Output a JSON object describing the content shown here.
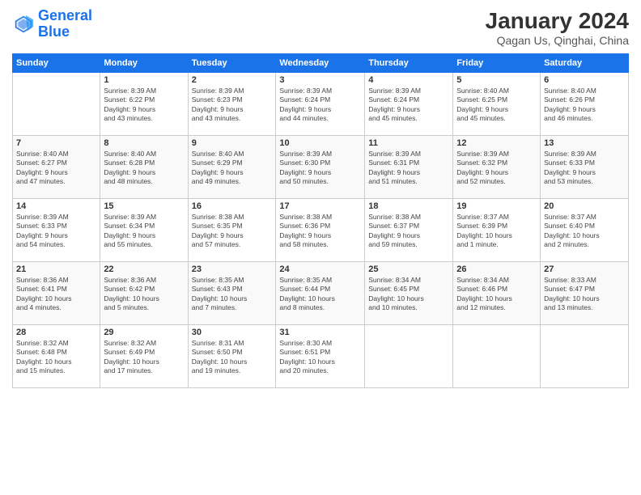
{
  "logo": {
    "line1": "General",
    "line2": "Blue"
  },
  "header": {
    "title": "January 2024",
    "subtitle": "Qagan Us, Qinghai, China"
  },
  "columns": [
    "Sunday",
    "Monday",
    "Tuesday",
    "Wednesday",
    "Thursday",
    "Friday",
    "Saturday"
  ],
  "weeks": [
    [
      {
        "day": "",
        "info": ""
      },
      {
        "day": "1",
        "info": "Sunrise: 8:39 AM\nSunset: 6:22 PM\nDaylight: 9 hours\nand 43 minutes."
      },
      {
        "day": "2",
        "info": "Sunrise: 8:39 AM\nSunset: 6:23 PM\nDaylight: 9 hours\nand 43 minutes."
      },
      {
        "day": "3",
        "info": "Sunrise: 8:39 AM\nSunset: 6:24 PM\nDaylight: 9 hours\nand 44 minutes."
      },
      {
        "day": "4",
        "info": "Sunrise: 8:39 AM\nSunset: 6:24 PM\nDaylight: 9 hours\nand 45 minutes."
      },
      {
        "day": "5",
        "info": "Sunrise: 8:40 AM\nSunset: 6:25 PM\nDaylight: 9 hours\nand 45 minutes."
      },
      {
        "day": "6",
        "info": "Sunrise: 8:40 AM\nSunset: 6:26 PM\nDaylight: 9 hours\nand 46 minutes."
      }
    ],
    [
      {
        "day": "7",
        "info": "Sunrise: 8:40 AM\nSunset: 6:27 PM\nDaylight: 9 hours\nand 47 minutes."
      },
      {
        "day": "8",
        "info": "Sunrise: 8:40 AM\nSunset: 6:28 PM\nDaylight: 9 hours\nand 48 minutes."
      },
      {
        "day": "9",
        "info": "Sunrise: 8:40 AM\nSunset: 6:29 PM\nDaylight: 9 hours\nand 49 minutes."
      },
      {
        "day": "10",
        "info": "Sunrise: 8:39 AM\nSunset: 6:30 PM\nDaylight: 9 hours\nand 50 minutes."
      },
      {
        "day": "11",
        "info": "Sunrise: 8:39 AM\nSunset: 6:31 PM\nDaylight: 9 hours\nand 51 minutes."
      },
      {
        "day": "12",
        "info": "Sunrise: 8:39 AM\nSunset: 6:32 PM\nDaylight: 9 hours\nand 52 minutes."
      },
      {
        "day": "13",
        "info": "Sunrise: 8:39 AM\nSunset: 6:33 PM\nDaylight: 9 hours\nand 53 minutes."
      }
    ],
    [
      {
        "day": "14",
        "info": "Sunrise: 8:39 AM\nSunset: 6:33 PM\nDaylight: 9 hours\nand 54 minutes."
      },
      {
        "day": "15",
        "info": "Sunrise: 8:39 AM\nSunset: 6:34 PM\nDaylight: 9 hours\nand 55 minutes."
      },
      {
        "day": "16",
        "info": "Sunrise: 8:38 AM\nSunset: 6:35 PM\nDaylight: 9 hours\nand 57 minutes."
      },
      {
        "day": "17",
        "info": "Sunrise: 8:38 AM\nSunset: 6:36 PM\nDaylight: 9 hours\nand 58 minutes."
      },
      {
        "day": "18",
        "info": "Sunrise: 8:38 AM\nSunset: 6:37 PM\nDaylight: 9 hours\nand 59 minutes."
      },
      {
        "day": "19",
        "info": "Sunrise: 8:37 AM\nSunset: 6:39 PM\nDaylight: 10 hours\nand 1 minute."
      },
      {
        "day": "20",
        "info": "Sunrise: 8:37 AM\nSunset: 6:40 PM\nDaylight: 10 hours\nand 2 minutes."
      }
    ],
    [
      {
        "day": "21",
        "info": "Sunrise: 8:36 AM\nSunset: 6:41 PM\nDaylight: 10 hours\nand 4 minutes."
      },
      {
        "day": "22",
        "info": "Sunrise: 8:36 AM\nSunset: 6:42 PM\nDaylight: 10 hours\nand 5 minutes."
      },
      {
        "day": "23",
        "info": "Sunrise: 8:35 AM\nSunset: 6:43 PM\nDaylight: 10 hours\nand 7 minutes."
      },
      {
        "day": "24",
        "info": "Sunrise: 8:35 AM\nSunset: 6:44 PM\nDaylight: 10 hours\nand 8 minutes."
      },
      {
        "day": "25",
        "info": "Sunrise: 8:34 AM\nSunset: 6:45 PM\nDaylight: 10 hours\nand 10 minutes."
      },
      {
        "day": "26",
        "info": "Sunrise: 8:34 AM\nSunset: 6:46 PM\nDaylight: 10 hours\nand 12 minutes."
      },
      {
        "day": "27",
        "info": "Sunrise: 8:33 AM\nSunset: 6:47 PM\nDaylight: 10 hours\nand 13 minutes."
      }
    ],
    [
      {
        "day": "28",
        "info": "Sunrise: 8:32 AM\nSunset: 6:48 PM\nDaylight: 10 hours\nand 15 minutes."
      },
      {
        "day": "29",
        "info": "Sunrise: 8:32 AM\nSunset: 6:49 PM\nDaylight: 10 hours\nand 17 minutes."
      },
      {
        "day": "30",
        "info": "Sunrise: 8:31 AM\nSunset: 6:50 PM\nDaylight: 10 hours\nand 19 minutes."
      },
      {
        "day": "31",
        "info": "Sunrise: 8:30 AM\nSunset: 6:51 PM\nDaylight: 10 hours\nand 20 minutes."
      },
      {
        "day": "",
        "info": ""
      },
      {
        "day": "",
        "info": ""
      },
      {
        "day": "",
        "info": ""
      }
    ]
  ]
}
